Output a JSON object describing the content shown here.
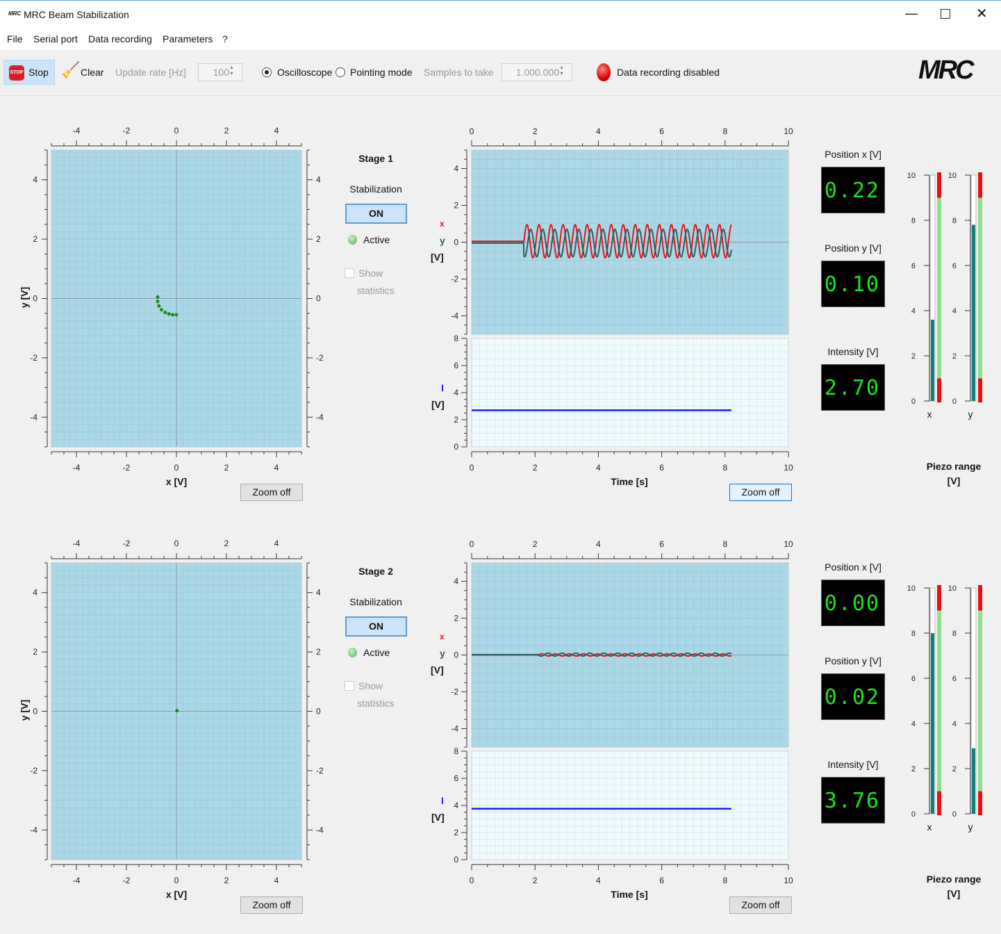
{
  "window": {
    "title": "MRC Beam Stabilization",
    "logo": "MRC",
    "controls": [
      "minimize-icon",
      "maximize-icon",
      "close-icon"
    ]
  },
  "menu": [
    "File",
    "Serial port",
    "Data recording",
    "Parameters",
    "?"
  ],
  "toolbar": {
    "stop_label": "Stop",
    "clear_label": "Clear",
    "update_rate_label": "Update rate [Hz]",
    "update_rate_value": "100",
    "mode_oscilloscope": "Oscilloscope",
    "mode_pointing": "Pointing mode",
    "selected_mode": "Oscilloscope",
    "samples_label": "Samples to take",
    "samples_value": "1.000.000",
    "recording_status": "Data recording disabled",
    "recording_led_color": "#e00000",
    "brand_logo": "MRC"
  },
  "colors": {
    "plot_bg": "#abd7e6",
    "intensity_bg": "#effafc",
    "x_signal": "#e8141e",
    "y_signal": "#2f5f5a",
    "intensity": "#1a1aff",
    "xy_points": "#1a8a1a",
    "piezo_fill": "#127f7f",
    "piezo_safe": "#90e090",
    "piezo_limit": "#e81010"
  },
  "stages": [
    {
      "title": "Stage 1",
      "stabilization_label": "Stabilization",
      "on_label": "ON",
      "active_label": "Active",
      "show_stats_1": "Show",
      "show_stats_2": "statistics",
      "show_stats_checked": false,
      "xy_plot": {
        "xlabel": "x [V]",
        "ylabel": "y [V]",
        "xlim": [
          -5,
          5
        ],
        "ylim": [
          -5,
          5
        ],
        "ticks": [
          -4,
          -2,
          0,
          2,
          4
        ],
        "points": [
          [
            -0.75,
            0.05
          ],
          [
            -0.75,
            -0.1
          ],
          [
            -0.7,
            -0.25
          ],
          [
            -0.6,
            -0.38
          ],
          [
            -0.45,
            -0.47
          ],
          [
            -0.3,
            -0.52
          ],
          [
            -0.15,
            -0.55
          ],
          [
            0.0,
            -0.55
          ]
        ]
      },
      "time_plot": {
        "xlabel": "Time [s]",
        "xlim": [
          0,
          10
        ],
        "xticks": [
          0,
          2,
          4,
          6,
          8,
          10
        ],
        "pos_ylabel_x": "x",
        "pos_ylabel_y": "y",
        "pos_ylabel_unit": "[V]",
        "pos_ylim": [
          -5,
          5
        ],
        "pos_yticks": [
          -4,
          -2,
          0,
          2,
          4
        ],
        "int_ylabel": "I",
        "int_ylabel_unit": "[V]",
        "int_ylim": [
          0,
          8
        ],
        "int_yticks": [
          0,
          2,
          4,
          6,
          8
        ],
        "x_signal": {
          "t_end": 8.2,
          "baseline": 0.05,
          "osc_start": 1.65,
          "amplitude": 0.9,
          "period": 0.38,
          "phase": 0
        },
        "y_signal": {
          "t_end": 8.2,
          "baseline": -0.05,
          "osc_start": 1.65,
          "amplitude": 0.75,
          "period": 0.38,
          "phase": 0.12
        },
        "intensity": {
          "t_end": 8.2,
          "value": 2.7
        }
      },
      "zoom_xy": "Zoom off",
      "zoom_time": "Zoom off",
      "readouts": {
        "pos_x_label": "Position x [V]",
        "pos_x": "0.22",
        "pos_y_label": "Position y [V]",
        "pos_y": "0.10",
        "intensity_label": "Intensity [V]",
        "intensity": "2.70"
      },
      "piezo": {
        "title_1": "Piezo range",
        "title_2": "[V]",
        "range": [
          0,
          10
        ],
        "ticks": [
          0,
          2,
          4,
          6,
          8,
          10
        ],
        "safe_range": [
          1,
          9
        ],
        "x": 3.6,
        "y": 7.8,
        "x_label": "x",
        "y_label": "y"
      }
    },
    {
      "title": "Stage 2",
      "stabilization_label": "Stabilization",
      "on_label": "ON",
      "active_label": "Active",
      "show_stats_1": "Show",
      "show_stats_2": "statistics",
      "show_stats_checked": false,
      "xy_plot": {
        "xlabel": "x [V]",
        "ylabel": "y [V]",
        "xlim": [
          -5,
          5
        ],
        "ylim": [
          -5,
          5
        ],
        "ticks": [
          -4,
          -2,
          0,
          2,
          4
        ],
        "points": [
          [
            0.02,
            0.02
          ]
        ]
      },
      "time_plot": {
        "xlabel": "Time [s]",
        "xlim": [
          0,
          10
        ],
        "xticks": [
          0,
          2,
          4,
          6,
          8,
          10
        ],
        "pos_ylabel_x": "x",
        "pos_ylabel_y": "y",
        "pos_ylabel_unit": "[V]",
        "pos_ylim": [
          -5,
          5
        ],
        "pos_yticks": [
          -4,
          -2,
          0,
          2,
          4
        ],
        "int_ylabel": "I",
        "int_ylabel_unit": "[V]",
        "int_ylim": [
          0,
          8
        ],
        "int_yticks": [
          0,
          2,
          4,
          6,
          8
        ],
        "x_signal": {
          "t_end": 8.2,
          "baseline": 0.0,
          "osc_start": 2.1,
          "amplitude": 0.06,
          "period": 0.44,
          "phase": 0
        },
        "y_signal": {
          "t_end": 8.2,
          "baseline": 0.02,
          "osc_start": 2.1,
          "amplitude": 0.08,
          "period": 0.44,
          "phase": 0.2
        },
        "intensity": {
          "t_end": 8.2,
          "value": 3.76
        }
      },
      "zoom_xy": "Zoom off",
      "zoom_time": "Zoom off",
      "readouts": {
        "pos_x_label": "Position x [V]",
        "pos_x": "0.00",
        "pos_y_label": "Position y [V]",
        "pos_y": "0.02",
        "intensity_label": "Intensity [V]",
        "intensity": "3.76"
      },
      "piezo": {
        "title_1": "Piezo range",
        "title_2": "[V]",
        "range": [
          0,
          10
        ],
        "ticks": [
          0,
          2,
          4,
          6,
          8,
          10
        ],
        "safe_range": [
          1,
          9
        ],
        "x": 8.0,
        "y": 2.9,
        "x_label": "x",
        "y_label": "y"
      }
    }
  ]
}
